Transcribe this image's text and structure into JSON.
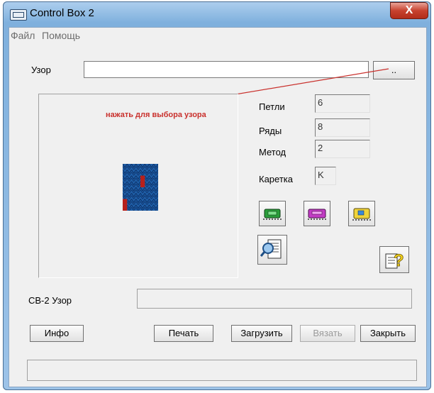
{
  "window": {
    "title": "Control Box 2",
    "close_label": "X"
  },
  "menu": {
    "file": "Файл",
    "help": "Помощь"
  },
  "pattern": {
    "label": "Узор",
    "value": "",
    "browse_label": "..",
    "hint": "нажать для выбора узора"
  },
  "params": [
    {
      "label": "Петли",
      "value": "6"
    },
    {
      "label": "Ряды",
      "value": "8"
    },
    {
      "label": "Метод",
      "value": "2"
    },
    {
      "label": "Каретка",
      "value": "K"
    }
  ],
  "cb2": {
    "label": "CB-2 Узор",
    "value": ""
  },
  "buttons": {
    "info": "Инфо",
    "print": "Печать",
    "load": "Загрузить",
    "knit": "Вязать",
    "close": "Закрыть"
  },
  "tool_icons": [
    "green-carriage-icon",
    "magenta-carriage-icon",
    "yellow-carriage-icon",
    "preview-document-icon",
    "help-document-icon"
  ],
  "colors": {
    "accent_red": "#c9302c",
    "pattern_blue": "#1f5fa8",
    "pattern_red": "#b8201a"
  },
  "status": ""
}
